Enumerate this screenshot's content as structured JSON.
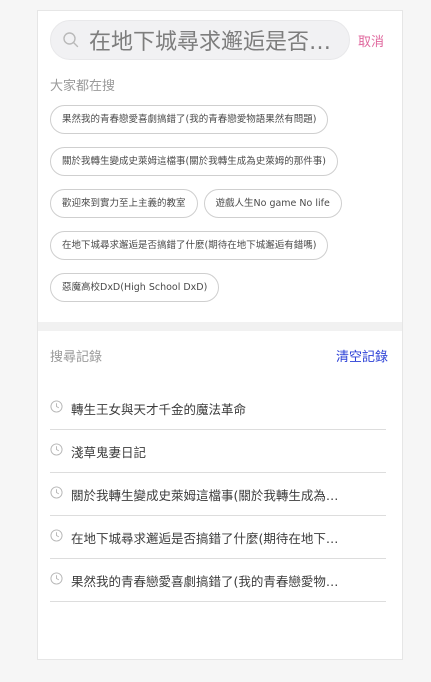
{
  "search": {
    "value": "在地下城尋求邂逅是否搞錯了什麼(期待在地下城邂逅有錯嗎)",
    "cancel_label": "取消",
    "icon": "search-icon"
  },
  "hot": {
    "title": "大家都在搜",
    "tags": [
      "果然我的青春戀愛喜劇搞錯了(我的青春戀愛物語果然有問題)",
      "關於我轉生變成史萊姆這檔事(關於我轉生成為史萊姆的那件事)",
      "歡迎來到實力至上主義的教室",
      "遊戲人生No game No life",
      "在地下城尋求邂逅是否搞錯了什麼(期待在地下城邂逅有錯嗎)",
      "惡魔高校DxD(High School DxD)"
    ]
  },
  "history": {
    "title": "搜尋記錄",
    "clear_label": "清空記錄",
    "icon": "clock-icon",
    "items": [
      "轉生王女與天才千金的魔法革命",
      "淺草鬼妻日記",
      "關於我轉生變成史萊姆這檔事(關於我轉生成為史萊姆的那件事)",
      "在地下城尋求邂逅是否搞錯了什麼(期待在地下城邂逅有錯嗎)",
      "果然我的青春戀愛喜劇搞錯了(我的青春戀愛物語果然有問題)"
    ]
  },
  "colors": {
    "accent_pink": "#e0689e",
    "link_blue": "#2a3fd6"
  }
}
